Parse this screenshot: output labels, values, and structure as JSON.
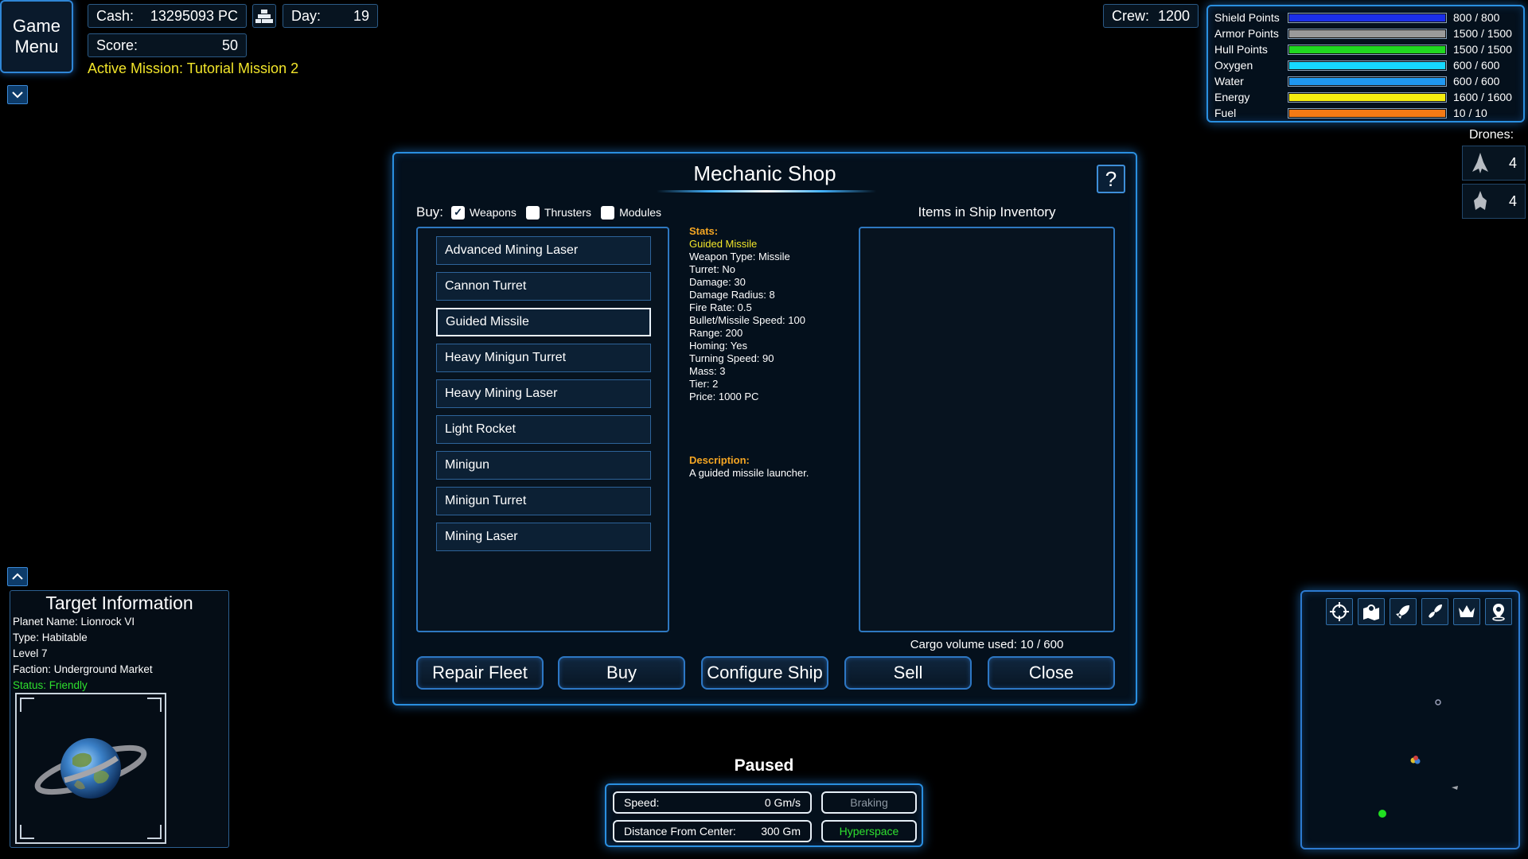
{
  "top_left": {
    "game_menu_label": "Game\nMenu",
    "cash_label": "Cash:",
    "cash_value": "13295093 PC",
    "day_label": "Day:",
    "day_value": "19",
    "score_label": "Score:",
    "score_value": "50",
    "active_mission": "Active Mission: Tutorial Mission 2"
  },
  "crew": {
    "label": "Crew:",
    "value": "1200"
  },
  "ship_bars": [
    {
      "label": "Shield Points",
      "value": "800 / 800",
      "fill": 1.0,
      "color": "#1b2fe8"
    },
    {
      "label": "Armor Points",
      "value": "1500 / 1500",
      "fill": 1.0,
      "color": "#9a9a9a"
    },
    {
      "label": "Hull Points",
      "value": "1500 / 1500",
      "fill": 1.0,
      "color": "#20d820"
    },
    {
      "label": "Oxygen",
      "value": "600 / 600",
      "fill": 1.0,
      "color": "#16d8ff"
    },
    {
      "label": "Water",
      "value": "600 / 600",
      "fill": 1.0,
      "color": "#1f97f0"
    },
    {
      "label": "Energy",
      "value": "1600 / 1600",
      "fill": 1.0,
      "color": "#f5ee10"
    },
    {
      "label": "Fuel",
      "value": "10 / 10",
      "fill": 1.0,
      "color": "#f57a14"
    }
  ],
  "drones": {
    "label": "Drones:",
    "counts": [
      "4",
      "4"
    ]
  },
  "shop": {
    "title": "Mechanic Shop",
    "help": "?",
    "buy_label": "Buy:",
    "filters": [
      {
        "label": "Weapons",
        "checked": true
      },
      {
        "label": "Thrusters",
        "checked": false
      },
      {
        "label": "Modules",
        "checked": false
      }
    ],
    "items": [
      "Advanced Mining Laser",
      "Cannon Turret",
      "Guided Missile",
      "Heavy Minigun Turret",
      "Heavy Mining Laser",
      "Light Rocket",
      "Minigun",
      "Minigun Turret",
      "Mining Laser"
    ],
    "selected_item": "Guided Missile",
    "stats_heading": "Stats:",
    "stats_name": "Guided Missile",
    "stats": [
      "Weapon Type: Missile",
      "Turret: No",
      "Damage: 30",
      "Damage Radius: 8",
      "Fire Rate: 0.5",
      "Bullet/Missile Speed: 100",
      "Range: 200",
      "Homing: Yes",
      "Turning Speed: 90",
      "Mass: 3",
      "Tier: 2",
      "Price: 1000 PC"
    ],
    "description_heading": "Description:",
    "description": "A guided missile launcher.",
    "inventory_title": "Items in Ship Inventory",
    "cargo": "Cargo volume used: 10 / 600",
    "buttons": [
      "Repair Fleet",
      "Buy",
      "Configure Ship",
      "Sell",
      "Close"
    ]
  },
  "target": {
    "title": "Target Information",
    "lines": [
      "Planet Name: Lionrock VI",
      "Type: Habitable",
      "Level 7",
      "Faction: Underground Market"
    ],
    "status": "Status: Friendly"
  },
  "bottom": {
    "paused": "Paused",
    "speed_label": "Speed:",
    "speed_value": "0 Gm/s",
    "braking": "Braking",
    "distance_label": "Distance From Center:",
    "distance_value": "300 Gm",
    "hyperspace": "Hyperspace"
  },
  "minimap_icons": [
    "crosshair-icon",
    "map-pin-icon",
    "rocket-icon",
    "fleet-icon",
    "crown-icon",
    "location-icon"
  ]
}
